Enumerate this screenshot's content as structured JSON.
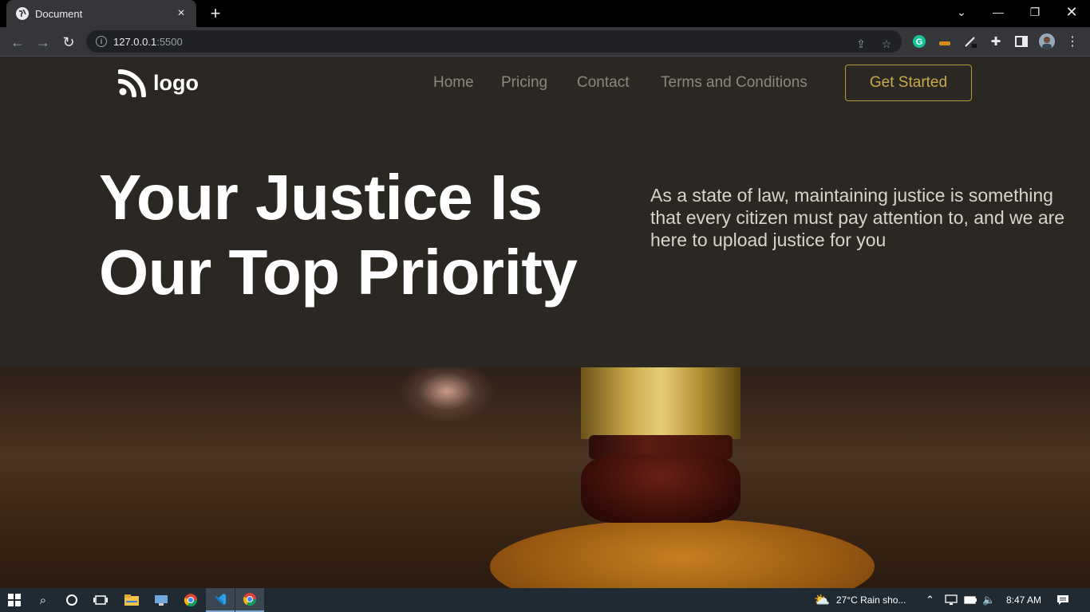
{
  "browser": {
    "tab_title": "Document",
    "close_tab": "×",
    "new_tab": "+",
    "url_host": "127.0.0.1",
    "url_port": ":5500"
  },
  "site": {
    "logo_text": "logo",
    "nav": [
      "Home",
      "Pricing",
      "Contact",
      "Terms and Conditions"
    ],
    "cta_label": "Get Started",
    "hero_title_line1": "Your Justice Is",
    "hero_title_line2": "Our Top Priority",
    "hero_description": "As a state of law, maintaining justice is something that every citizen must pay attention to, and we are here to upload justice for you",
    "colors": {
      "background": "#2b2722",
      "accent": "#c8a94a",
      "nav_text": "#8b8880"
    }
  },
  "taskbar": {
    "weather": "27°C  Rain sho...",
    "time": "8:47 AM"
  }
}
